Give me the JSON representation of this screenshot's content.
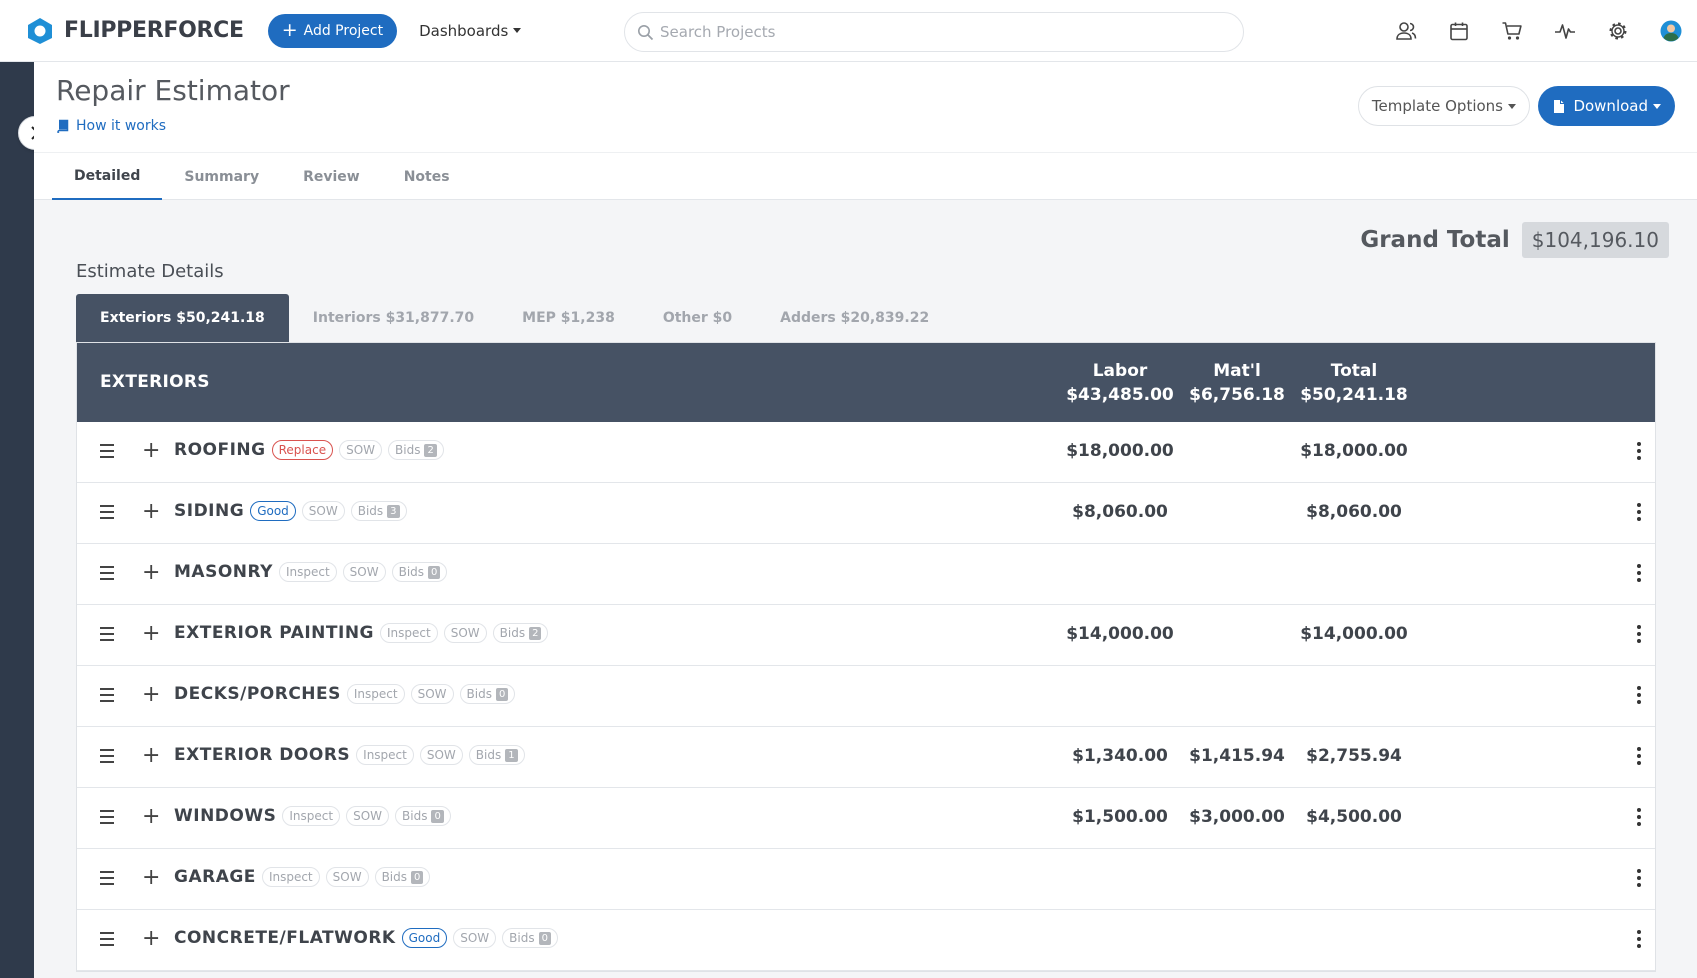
{
  "nav": {
    "brand": "FLIPPERFORCE",
    "add_project": "Add Project",
    "dashboards": "Dashboards",
    "search_placeholder": "Search Projects",
    "icons": [
      "users-icon",
      "calendar-icon",
      "cart-icon",
      "activity-icon",
      "gear-icon",
      "avatar"
    ]
  },
  "page": {
    "title": "Repair Estimator",
    "how_it_works": "How it works",
    "template_options": "Template Options",
    "download": "Download"
  },
  "tabs": [
    "Detailed",
    "Summary",
    "Review",
    "Notes"
  ],
  "grand_total": {
    "label": "Grand Total",
    "value": "$104,196.10"
  },
  "estimate_details": "Estimate Details",
  "categories": [
    {
      "label": "Exteriors $50,241.18",
      "active": true
    },
    {
      "label": "Interiors $31,877.70",
      "active": false
    },
    {
      "label": "MEP $1,238",
      "active": false
    },
    {
      "label": "Other $0",
      "active": false
    },
    {
      "label": "Adders $20,839.22",
      "active": false
    }
  ],
  "table": {
    "title": "EXTERIORS",
    "columns": [
      {
        "name": "Labor",
        "value": "$43,485.00"
      },
      {
        "name": "Mat'l",
        "value": "$6,756.18"
      },
      {
        "name": "Total",
        "value": "$50,241.18"
      }
    ],
    "rows": [
      {
        "name": "ROOFING",
        "status": "Replace",
        "status_color": "red",
        "sow": "SOW",
        "bids": "Bids",
        "bid_count": "2",
        "labor": "$18,000.00",
        "material": "",
        "total": "$18,000.00"
      },
      {
        "name": "SIDING",
        "status": "Good",
        "status_color": "blue",
        "sow": "SOW",
        "bids": "Bids",
        "bid_count": "3",
        "labor": "$8,060.00",
        "material": "",
        "total": "$8,060.00"
      },
      {
        "name": "MASONRY",
        "status": "Inspect",
        "status_color": "gray",
        "sow": "SOW",
        "bids": "Bids",
        "bid_count": "0",
        "labor": "",
        "material": "",
        "total": ""
      },
      {
        "name": "EXTERIOR PAINTING",
        "status": "Inspect",
        "status_color": "gray",
        "sow": "SOW",
        "bids": "Bids",
        "bid_count": "2",
        "labor": "$14,000.00",
        "material": "",
        "total": "$14,000.00"
      },
      {
        "name": "DECKS/PORCHES",
        "status": "Inspect",
        "status_color": "gray",
        "sow": "SOW",
        "bids": "Bids",
        "bid_count": "0",
        "labor": "",
        "material": "",
        "total": ""
      },
      {
        "name": "EXTERIOR DOORS",
        "status": "Inspect",
        "status_color": "gray",
        "sow": "SOW",
        "bids": "Bids",
        "bid_count": "1",
        "labor": "$1,340.00",
        "material": "$1,415.94",
        "total": "$2,755.94"
      },
      {
        "name": "WINDOWS",
        "status": "Inspect",
        "status_color": "gray",
        "sow": "SOW",
        "bids": "Bids",
        "bid_count": "0",
        "labor": "$1,500.00",
        "material": "$3,000.00",
        "total": "$4,500.00"
      },
      {
        "name": "GARAGE",
        "status": "Inspect",
        "status_color": "gray",
        "sow": "SOW",
        "bids": "Bids",
        "bid_count": "0",
        "labor": "",
        "material": "",
        "total": ""
      },
      {
        "name": "CONCRETE/FLATWORK",
        "status": "Good",
        "status_color": "blue",
        "sow": "SOW",
        "bids": "Bids",
        "bid_count": "0",
        "labor": "",
        "material": "",
        "total": ""
      }
    ]
  },
  "colors": {
    "primary": "#1f6cc0",
    "header_dark": "#465264",
    "rail": "#2f3a4b",
    "status_red": "#d9534f"
  }
}
